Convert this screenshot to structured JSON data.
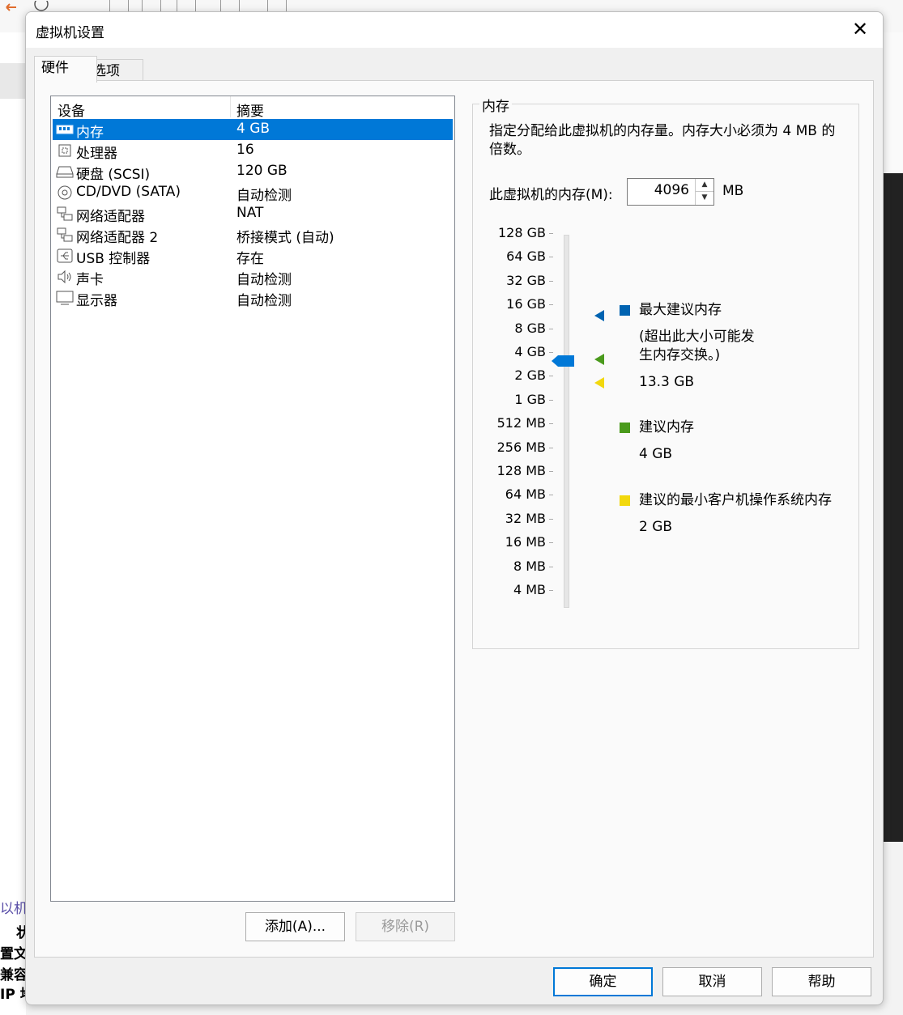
{
  "dialog": {
    "title": "虚拟机设置"
  },
  "tabs": [
    {
      "label": "硬件"
    },
    {
      "label": "选项"
    }
  ],
  "device_list": {
    "headers": {
      "device": "设备",
      "summary": "摘要"
    },
    "rows": [
      {
        "name": "内存",
        "summary": "4 GB",
        "icon": "memory-icon",
        "selected": true
      },
      {
        "name": "处理器",
        "summary": "16",
        "icon": "processor-icon"
      },
      {
        "name": "硬盘 (SCSI)",
        "summary": "120 GB",
        "icon": "hard-disk-icon"
      },
      {
        "name": "CD/DVD (SATA)",
        "summary": "自动检测",
        "icon": "cd-dvd-icon"
      },
      {
        "name": "网络适配器",
        "summary": "NAT",
        "icon": "network-adapter-icon"
      },
      {
        "name": "网络适配器 2",
        "summary": "桥接模式 (自动)",
        "icon": "network-adapter-icon"
      },
      {
        "name": "USB 控制器",
        "summary": "存在",
        "icon": "usb-icon"
      },
      {
        "name": "声卡",
        "summary": "自动检测",
        "icon": "sound-icon"
      },
      {
        "name": "显示器",
        "summary": "自动检测",
        "icon": "display-icon"
      }
    ]
  },
  "list_buttons": {
    "add": "添加(A)...",
    "remove": "移除(R)"
  },
  "memory": {
    "group_title": "内存",
    "description": "指定分配给此虚拟机的内存量。内存大小必须为 4 MB 的倍数。",
    "field_label": "此虚拟机的内存(M):",
    "value": "4096",
    "unit": "MB",
    "scale_ticks": [
      "128 GB",
      "64 GB",
      "32 GB",
      "16 GB",
      "8 GB",
      "4 GB",
      "2 GB",
      "1 GB",
      "512 MB",
      "256 MB",
      "128 MB",
      "64 MB",
      "32 MB",
      "16 MB",
      "8 MB",
      "4 MB"
    ],
    "slider_value": "4 GB",
    "legend": {
      "max_title": "最大建议内存",
      "max_note": "(超出此大小可能发生内存交换。)",
      "max_value": "13.3 GB",
      "rec_title": "建议内存",
      "rec_value": "4 GB",
      "min_title": "建议的最小客户机操作系统内存",
      "min_value": "2 GB"
    },
    "colors": {
      "max": "#0063b1",
      "recommended": "#4a9a1c",
      "minimum": "#f2d80d",
      "thumb": "#0078d7"
    }
  },
  "footer": {
    "ok": "确定",
    "cancel": "取消",
    "help": "帮助"
  },
  "background": {
    "side_labels": [
      "以机",
      "状",
      "置文",
      "兼容",
      "IP 地"
    ]
  }
}
